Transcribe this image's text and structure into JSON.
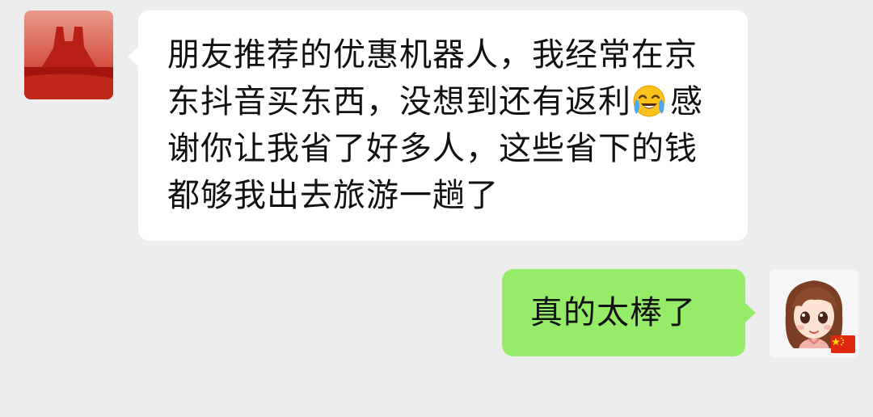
{
  "chat": {
    "incoming": {
      "sender_avatar": "red-rock-butte-avatar",
      "text_before_emoji": "朋友推荐的优惠机器人，我经常在京东抖音买东西，没想到还有返利",
      "emoji": "face-with-tears-of-joy-emoji",
      "text_after_emoji": "感谢你让我省了好多人，这些省下的钱都够我出去旅游一趟了",
      "bubble_color": "#ffffff"
    },
    "outgoing": {
      "sender_avatar": "cartoon-girl-avatar",
      "badge": "china-flag-icon",
      "text": "真的太棒了",
      "bubble_color": "#95ec69"
    }
  },
  "colors": {
    "background": "#ededed"
  }
}
